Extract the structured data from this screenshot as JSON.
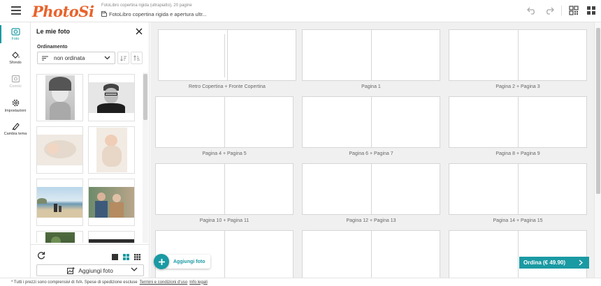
{
  "header": {
    "logo": "PhotoSi",
    "product_subtitle": "FotoLibro copertina rigida (ultrapiatto), 20 pagine",
    "product_title": "FotoLibro copertina rigida e apertura ultr..."
  },
  "leftnav": {
    "items": [
      {
        "label": "Foto",
        "icon": "camera-icon",
        "active": true
      },
      {
        "label": "Sfondo",
        "icon": "paint-bucket-icon"
      },
      {
        "label": "Cornici",
        "icon": "frame-icon",
        "disabled": true
      },
      {
        "label": "Impostazioni",
        "icon": "gear-icon"
      },
      {
        "label": "Cambia tema",
        "icon": "brush-icon"
      }
    ]
  },
  "panel": {
    "title": "Le mie foto",
    "sort_label": "Ordinamento",
    "sort_value": "non ordinata",
    "add_photo_label": "Aggiungi foto"
  },
  "spreads": [
    {
      "label": "Retro Copertina + Fronte Copertina"
    },
    {
      "label": "Pagina 1"
    },
    {
      "label": "Pagina 2 + Pagina 3"
    },
    {
      "label": "Pagina 4 + Pagina 5"
    },
    {
      "label": "Pagina 6 + Pagina 7"
    },
    {
      "label": "Pagina 8 + Pagina 9"
    },
    {
      "label": "Pagina 10 + Pagina 11"
    },
    {
      "label": "Pagina 12 + Pagina 13"
    },
    {
      "label": "Pagina 14 + Pagina 15"
    },
    {
      "label": ""
    },
    {
      "label": ""
    },
    {
      "label": ""
    }
  ],
  "fab": {
    "label": "Aggiungi foto"
  },
  "order": {
    "label": "Ordina (€ 49.90)"
  },
  "footer": {
    "text": "* Tutti i prezzi sono comprensivi di IVA. Spese di spedizione escluse",
    "terms_link": "Termini e condizioni d'uso",
    "info_link": "Info legali"
  },
  "colors": {
    "accent": "#1a9aa3",
    "brand": "#e8632b"
  }
}
